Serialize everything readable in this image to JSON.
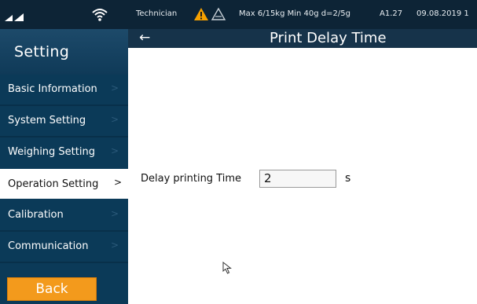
{
  "status_bar": {
    "signal_icon": "signal-icon",
    "wifi_icon": "wifi-icon",
    "user": "Technician",
    "warning_icon": "warning-triangle-icon",
    "scale_icon": "scale-icon",
    "capacity": "Max 6/15kg Min 40g d=2/5g",
    "version": "A1.27",
    "date": "09.08.2019 1"
  },
  "sidebar": {
    "title": "Setting",
    "items": [
      {
        "label": "Basic Information",
        "active": false
      },
      {
        "label": "System Setting",
        "active": false
      },
      {
        "label": "Weighing Setting",
        "active": false
      },
      {
        "label": "Operation Setting",
        "active": true
      },
      {
        "label": "Calibration",
        "active": false
      },
      {
        "label": "Communication",
        "active": false
      }
    ],
    "chevron": ">",
    "back_label": "Back"
  },
  "header": {
    "back_arrow": "←",
    "title": "Print Delay Time"
  },
  "form": {
    "label": "Delay printing Time",
    "value": "2",
    "unit": "s"
  },
  "colors": {
    "status_bar_bg": "#0d2436",
    "sidebar_bg": "#0b3a58",
    "header_bg": "#16334a",
    "back_button_bg": "#f39a1c",
    "active_item_bg": "#ffffff"
  }
}
